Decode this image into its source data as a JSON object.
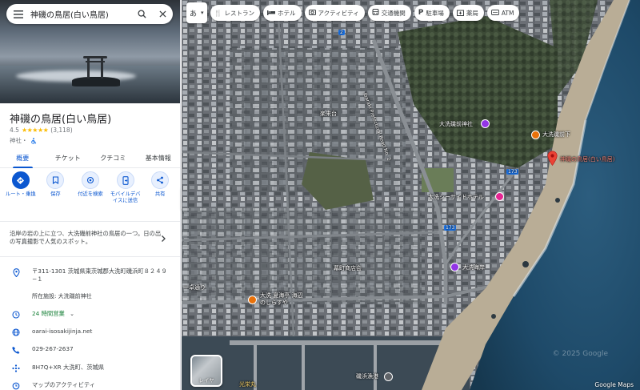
{
  "search": {
    "query": "神磯の鳥居(白い鳥居)"
  },
  "place": {
    "title": "神磯の鳥居(白い鳥居)",
    "rating": "4.5",
    "stars": "★★★★★",
    "review_count": "(3,118)",
    "category": "神社・"
  },
  "tabs": [
    {
      "label": "概要"
    },
    {
      "label": "チケット"
    },
    {
      "label": "クチコミ"
    },
    {
      "label": "基本情報"
    }
  ],
  "actions": [
    {
      "label": "ルート・乗換",
      "icon": "directions-icon"
    },
    {
      "label": "保存",
      "icon": "bookmark-icon"
    },
    {
      "label": "付近を検索",
      "icon": "nearby-icon"
    },
    {
      "label": "モバイルデバイスに送信",
      "icon": "send-to-phone-icon"
    },
    {
      "label": "共有",
      "icon": "share-icon"
    }
  ],
  "description": "沿岸の岩の上に立つ、大洗磯前神社の鳥居の一つ。日の出の写真撮影で人気のスポット。",
  "info": {
    "address": "〒311-1301 茨城県東茨城郡大洗町磯浜町８２４９−１",
    "located_in": "所在施設: 大洗磯前神社",
    "hours": "24 時間営業",
    "website": "oarai-isosakijinja.net",
    "phone": "029-267-2637",
    "plus_code": "8H7Q+XR 大洗町、茨城県",
    "activity": "マップのアクティビティ"
  },
  "chips": {
    "lang": "あ",
    "items": [
      {
        "label": "レストラン",
        "icon": "restaurant-icon"
      },
      {
        "label": "ホテル",
        "icon": "hotel-icon"
      },
      {
        "label": "アクティビティ",
        "icon": "camera-icon"
      },
      {
        "label": "交通機関",
        "icon": "transit-icon"
      },
      {
        "label": "駐車場",
        "icon": "parking-icon"
      },
      {
        "label": "薬局",
        "icon": "pharmacy-icon"
      },
      {
        "label": "ATM",
        "icon": "atm-icon"
      }
    ]
  },
  "map_labels": {
    "torii": "神磯の鳥居(白い鳥居)",
    "shrine": "大洗磯前神社",
    "hotel": "大洗シーサイドホテル",
    "park": "大洗海岸",
    "inn": "大洗 夏海亭 海辺のしらすや",
    "school": "磯浜漁港",
    "road": "茨城県道173号",
    "gorou": "大洗磯前下",
    "misc_top": "楽来台",
    "kaikaku": "幕町商店会",
    "road2": "一卓通り",
    "shop": "光栄丸",
    "num_2": "2",
    "num_173a": "173",
    "num_173b": "173",
    "inner_road": "Ibaraki Prefectural Road No. 2"
  },
  "layer_label": "レイヤ",
  "attribution": "Google Maps",
  "watermark": "© 2025 Google",
  "colors": {
    "accent": "#0b57d0",
    "star": "#fbbc04",
    "pin": "#ea4335",
    "open": "#188038"
  }
}
